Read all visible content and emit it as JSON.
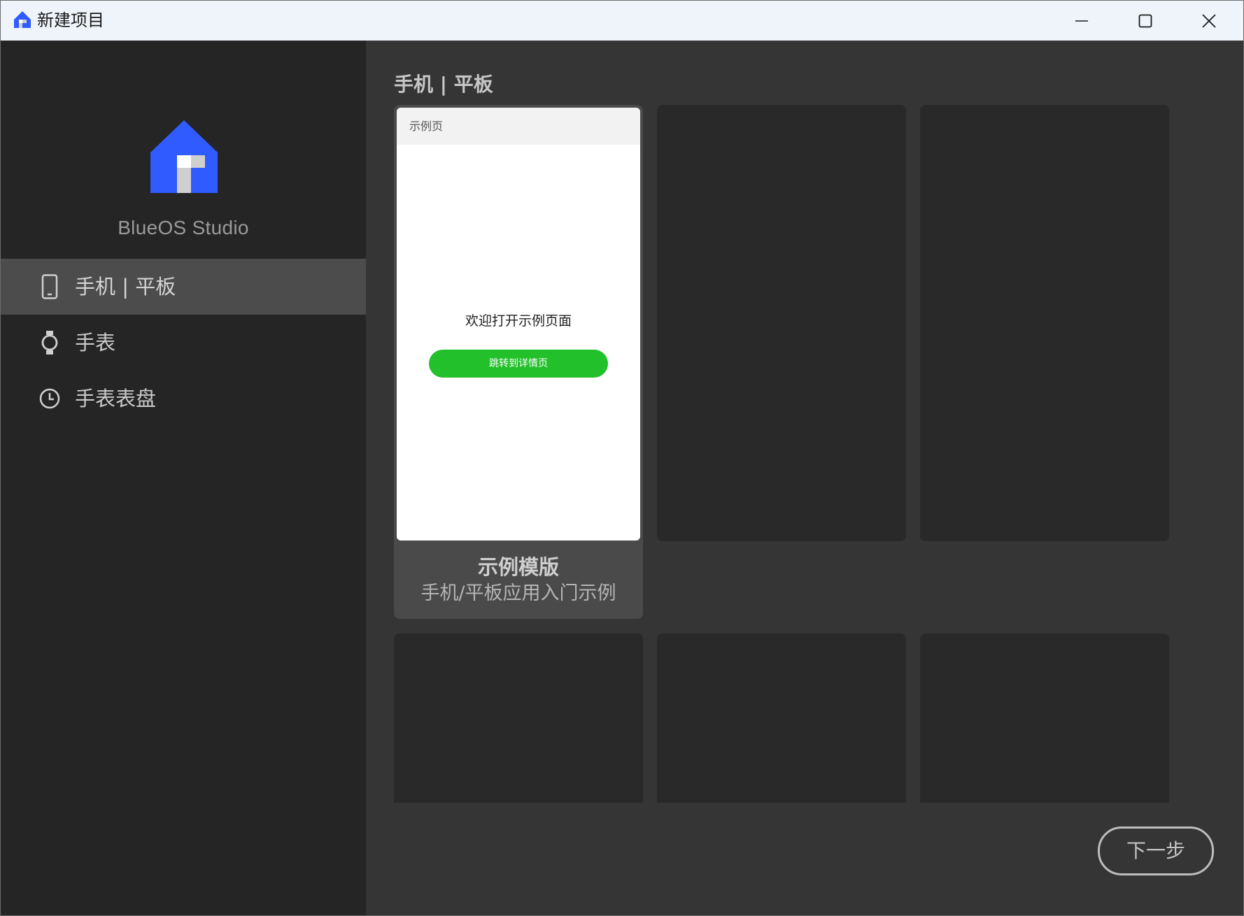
{
  "window": {
    "title": "新建项目",
    "app_icon": "blueos-house-icon",
    "controls": [
      "minimize-icon",
      "maximize-icon",
      "close-icon"
    ]
  },
  "sidebar": {
    "brand": "BlueOS Studio",
    "items": [
      {
        "label": "手机 | 平板",
        "icon": "phone-icon",
        "active": true
      },
      {
        "label": "手表",
        "icon": "watch-icon",
        "active": false
      },
      {
        "label": "手表表盘",
        "icon": "clock-icon",
        "active": false
      }
    ]
  },
  "main": {
    "section_title": "手机 | 平板",
    "featured_template": {
      "preview": {
        "header_title": "示例页",
        "welcome_text": "欢迎打开示例页面",
        "button_label": "跳转到详情页"
      },
      "title": "示例模版",
      "description": "手机/平板应用入门示例"
    },
    "next_button": "下一步"
  },
  "colors": {
    "accent_blue": "#2f5bff",
    "sidebar_bg": "#252525",
    "main_bg": "#353535",
    "card_bg": "#292929",
    "active_item_bg": "#4c4c4c",
    "preview_button_green": "#22c02a"
  }
}
